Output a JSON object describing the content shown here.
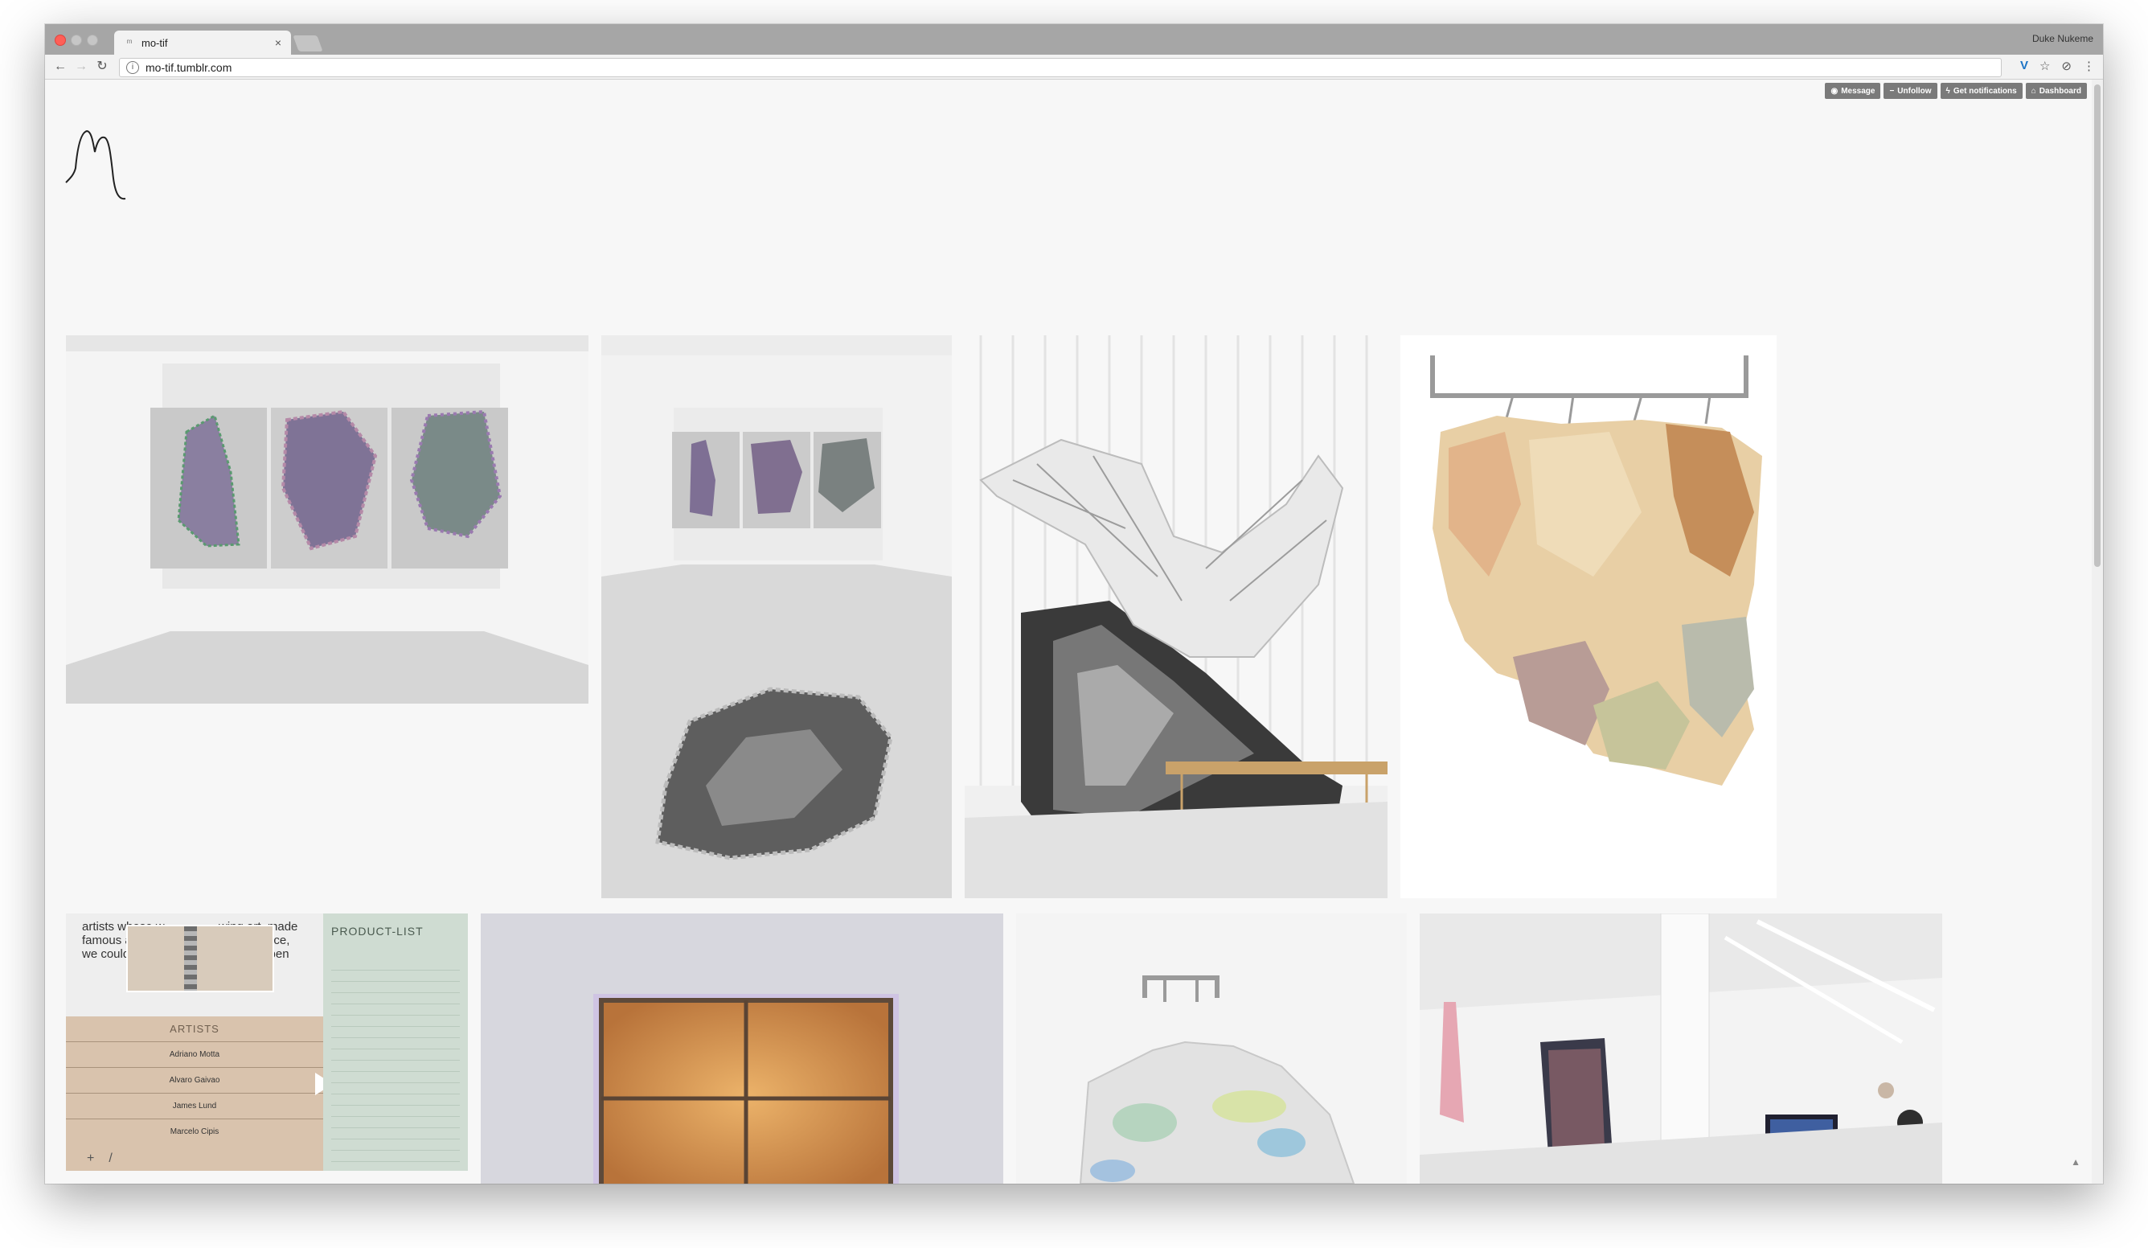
{
  "browser": {
    "tab_title": "mo-tif",
    "url": "mo-tif.tumblr.com",
    "profile_name": "Duke Nukeme"
  },
  "tumblr_controls": {
    "message": "Message",
    "unfollow": "Unfollow",
    "notifications": "Get notifications",
    "dashboard": "Dashboard"
  },
  "tile5": {
    "header_text_lines": [
      "artists whose w",
      "famous and w",
      "we couldn't h"
    ],
    "side_text_lines": [
      "wing art, made",
      "uch instance,",
      "Shop is open"
    ],
    "artists_heading": "ARTISTS",
    "artists": [
      "Adriano Motta",
      "Alvaro Gaivao",
      "James Lund",
      "Marcelo Cipis"
    ],
    "product_heading": "PRODUCT-LIST",
    "controls": [
      "+",
      "/"
    ]
  },
  "colors": {
    "tumblr_button": "#7a7a7a",
    "accent_blue": "#1d74c5"
  }
}
